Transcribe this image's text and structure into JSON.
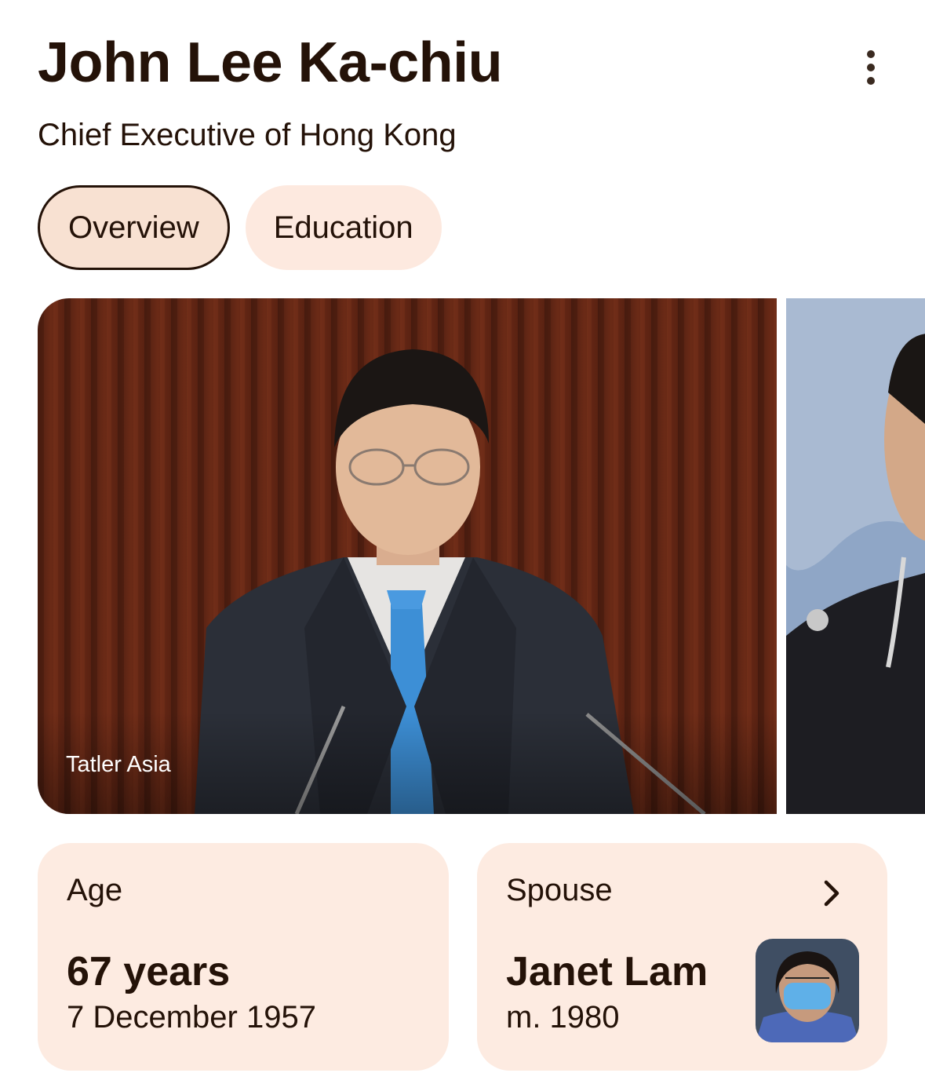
{
  "header": {
    "title": "John Lee Ka-chiu",
    "subtitle": "Chief Executive of Hong Kong"
  },
  "tabs": [
    {
      "label": "Overview",
      "selected": true
    },
    {
      "label": "Education",
      "selected": false
    }
  ],
  "images": {
    "main_source": "Tatler Asia"
  },
  "facts": {
    "age": {
      "label": "Age",
      "value": "67 years",
      "detail": "7 December 1957"
    },
    "spouse": {
      "label": "Spouse",
      "value": "Janet Lam",
      "detail": "m. 1980"
    }
  },
  "colors": {
    "text": "#241208",
    "chip_bg": "#fde9df",
    "card_bg": "#fdebe1"
  },
  "icons": {
    "menu": "more-vert-icon",
    "spouse_link": "chevron-right-icon"
  }
}
